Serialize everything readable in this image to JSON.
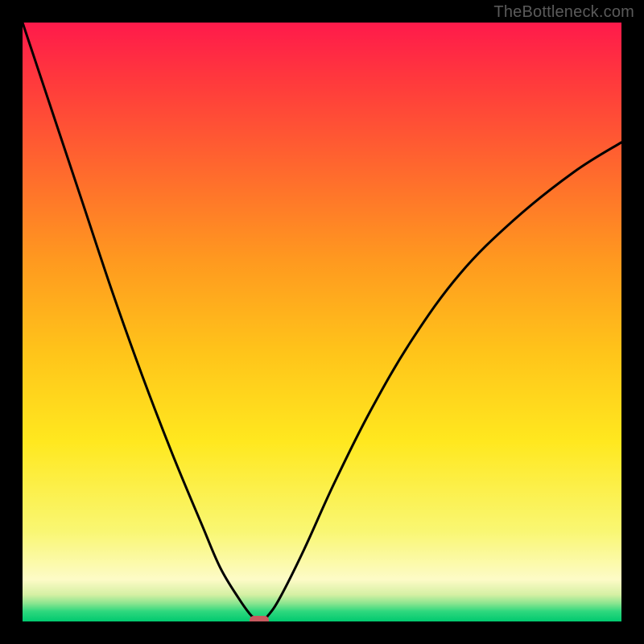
{
  "watermark": "TheBottleneck.com",
  "chart_data": {
    "type": "line",
    "title": "",
    "xlabel": "",
    "ylabel": "",
    "xlim": [
      0,
      100
    ],
    "ylim": [
      0,
      100
    ],
    "series": [
      {
        "name": "bottleneck-curve",
        "x": [
          0,
          5,
          10,
          15,
          20,
          25,
          30,
          33,
          36,
          38,
          39,
          40,
          41,
          43,
          47,
          52,
          58,
          65,
          73,
          82,
          92,
          100
        ],
        "values": [
          100,
          85,
          70,
          55,
          41,
          28,
          16,
          9,
          4,
          1.2,
          0.5,
          0.3,
          1,
          4,
          12,
          23,
          35,
          47,
          58,
          67,
          75,
          80
        ]
      }
    ],
    "minimum_marker": {
      "x": 39.5,
      "y": 0.3
    },
    "gradient_stops": [
      {
        "pct": 0,
        "color": "#ff1a4b"
      },
      {
        "pct": 10,
        "color": "#ff3a3c"
      },
      {
        "pct": 25,
        "color": "#ff6a2d"
      },
      {
        "pct": 40,
        "color": "#ff9a1f"
      },
      {
        "pct": 55,
        "color": "#ffc41a"
      },
      {
        "pct": 70,
        "color": "#ffe81f"
      },
      {
        "pct": 85,
        "color": "#f9f773"
      },
      {
        "pct": 93,
        "color": "#fdfbc7"
      },
      {
        "pct": 95.5,
        "color": "#d6f0a4"
      },
      {
        "pct": 97,
        "color": "#8ae58f"
      },
      {
        "pct": 98.3,
        "color": "#2fd87e"
      },
      {
        "pct": 100,
        "color": "#00c96f"
      }
    ]
  }
}
